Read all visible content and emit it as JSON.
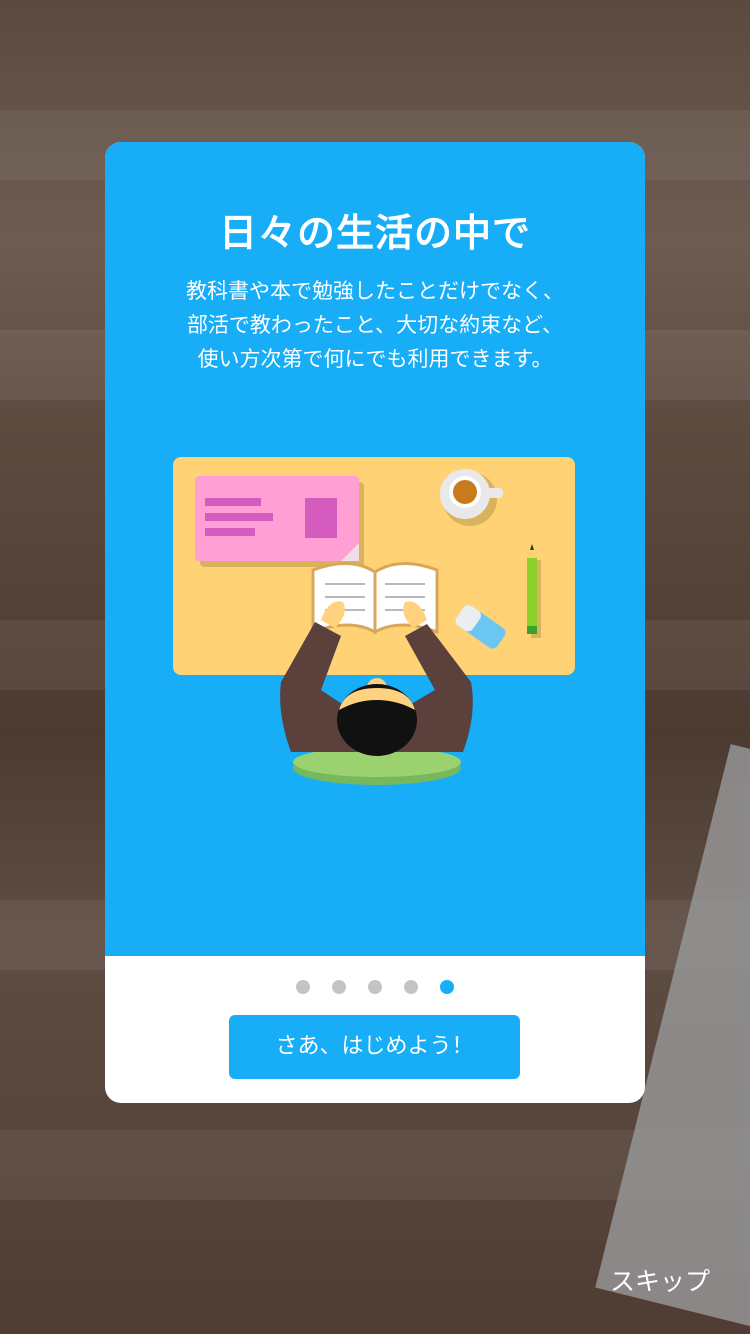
{
  "onboarding": {
    "title": "日々の生活の中で",
    "description": [
      "教科書や本で勉強したことだけでなく、",
      "部活で教わったこと、大切な約束など、",
      "使い方次第で何にでも利用できます。"
    ],
    "illustration_icon": "student-studying-at-desk-illustration",
    "pagination": {
      "total": 5,
      "current": 5
    },
    "start_button_label": "さあ、はじめよう！",
    "skip_label": "スキップ"
  },
  "colors": {
    "accent": "#18adf7",
    "card_bottom": "#ffffff",
    "dot_inactive": "#c4c4c4"
  }
}
